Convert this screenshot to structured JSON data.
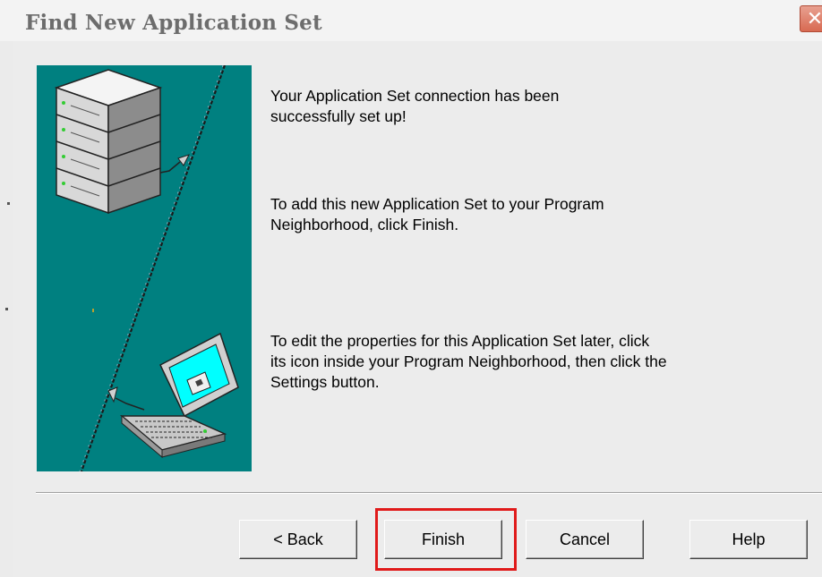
{
  "window": {
    "title": "Find New Application Set",
    "close_glyph": "✕"
  },
  "messages": {
    "success": "Your Application Set connection has been\nsuccessfully set up!",
    "add": "To add this new Application Set to your Program\nNeighborhood, click Finish.",
    "edit": "To edit the properties for this Application Set later, click\nits icon inside your Program Neighborhood, then click the\nSettings button."
  },
  "buttons": {
    "back": "< Back",
    "finish": "Finish",
    "cancel": "Cancel",
    "help": "Help"
  },
  "illustration": {
    "background": "#008080",
    "icons": [
      "server-stack-icon",
      "laptop-icon"
    ]
  },
  "highlight": {
    "target": "finish-button",
    "color": "#e01a1a"
  }
}
